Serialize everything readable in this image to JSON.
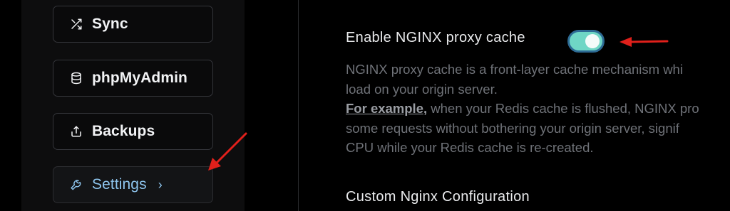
{
  "sidebar": {
    "items": [
      {
        "label": "Sync",
        "icon": "shuffle-icon"
      },
      {
        "label": "phpMyAdmin",
        "icon": "database-icon"
      },
      {
        "label": "Backups",
        "icon": "upload-icon"
      },
      {
        "label": "Settings",
        "icon": "wrench-icon",
        "active": true,
        "chevron": "›"
      }
    ]
  },
  "main": {
    "nginx_cache": {
      "title": "Enable NGINX proxy cache",
      "enabled": true,
      "description_lines": [
        "NGINX proxy cache is a front-layer cache mechanism whi",
        "load on your origin server."
      ],
      "example_label": "For example,",
      "example_line_rest": " when your Redis cache is flushed, NGINX pro",
      "description_tail_lines": [
        "some requests without bothering your origin server, signif",
        "CPU while your Redis cache is re-created."
      ]
    },
    "custom_config": {
      "title": "Custom Nginx Configuration"
    }
  },
  "colors": {
    "accent": "#8ec5ee",
    "toggle_on": "#6fd6c5",
    "annotation_arrow": "#e0201b"
  }
}
